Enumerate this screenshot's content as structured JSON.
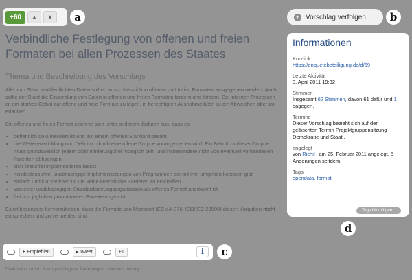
{
  "vote": {
    "count": "+60",
    "up_icon": "chevron-up-icon",
    "down_icon": "chevron-down-icon"
  },
  "callouts": {
    "a": "a",
    "b": "b",
    "c": "c",
    "d": "d"
  },
  "follow": {
    "label": "Vorschlag verfolgen"
  },
  "main": {
    "title": "Verbindliche Festlegung von offenen und freien Formaten bei allen Prozessen des Staates",
    "section_title": "Thema und Beschreibung des Vorschlags",
    "para1": "Alle vom Staat veröffentlichten Daten sollten ausschliesslich in offenen und freien Formaten ausgegeben werden. Auch sollte der Staat die Einsendung von Daten in offenen und freien Formaten fordern und fördern. Bei internen Prozessen ist ein starkes Gebot auf offene und freie Formate zu legen, in berechtigten Ausnahmefällen ist ein Abweichen aber zu erlauben.",
    "para2": "Ein offenes und freies Format zeichnet sich unter anderem dadurch aus, dass es",
    "list": [
      "oeffentlich dokumentiert ist und auf einem offenen Standard basiert",
      "die Weiterentwicklung und Definiton durch eine offene Gruppe vorangetrieben wird. Ein Beitritt zu dieser Gruppe muss grundsaetzlich jedem diskriminierungsfrei moeglich sein und insbesondere nicht von eventuell vorhandenen Patenten abhaengen",
      "sich lizenzfrei implementieren laesst",
      "mindestens zwei unabhaengige Implementierungen von Programmen die mit ihm umgehen koennen gibt",
      "einfach und klar definiert ist um keine kuenstliche Barrieren zu erschaffen",
      "von einer unabhaengigen Standardisierungsorganisation als offenes Format anerkannt ist",
      "frei von jeglichen proprietaeren Erweiterungen ist"
    ],
    "para3a": "Es ist besonders hervorzuheben, dass die Formate von Microsoft (ECMA-376, ISO/IEC 29500) diesen Vorgaben ",
    "para3b": "nicht",
    "para3c": " entsprechen und zu vermeiden sind"
  },
  "share": {
    "recommend": "Empfehlen",
    "tweet": "Tweet",
    "plusone": "+1",
    "info": "i"
  },
  "footer": {
    "text": "Diskussion zu +6 · 6 vorgeschlagene Änderungen · melden · history"
  },
  "info": {
    "title": "Informationen",
    "short_label": "Kurzlink",
    "short_val": "https://enquetebeteiligung.de/d/69",
    "activity_label": "Letzte Aktivität",
    "activity_val": "3. April 2011 19:32",
    "votes_label": "Stimmen",
    "votes_pre": "Insgesamt ",
    "votes_link": "62 Stimmen",
    "votes_mid": ", davon 61 dafür und ",
    "votes_link2": "1",
    "votes_post": " dagegen.",
    "date_label": "Termine",
    "date_val": "Dieser Vorschlag bezieht sich auf den gelbschten Termin Projektgruppensitzung Demokratie und Staat .",
    "created_label": "angelegt",
    "created_pre": "von ",
    "created_link": "RichiH",
    "created_post": " am 25. Februar 2011 angelegt, 5 Änderungen seitdem.",
    "tags_label": "Tags",
    "tags_val": "opendata, format",
    "tag_btn": "Tags hinzufügen..."
  }
}
